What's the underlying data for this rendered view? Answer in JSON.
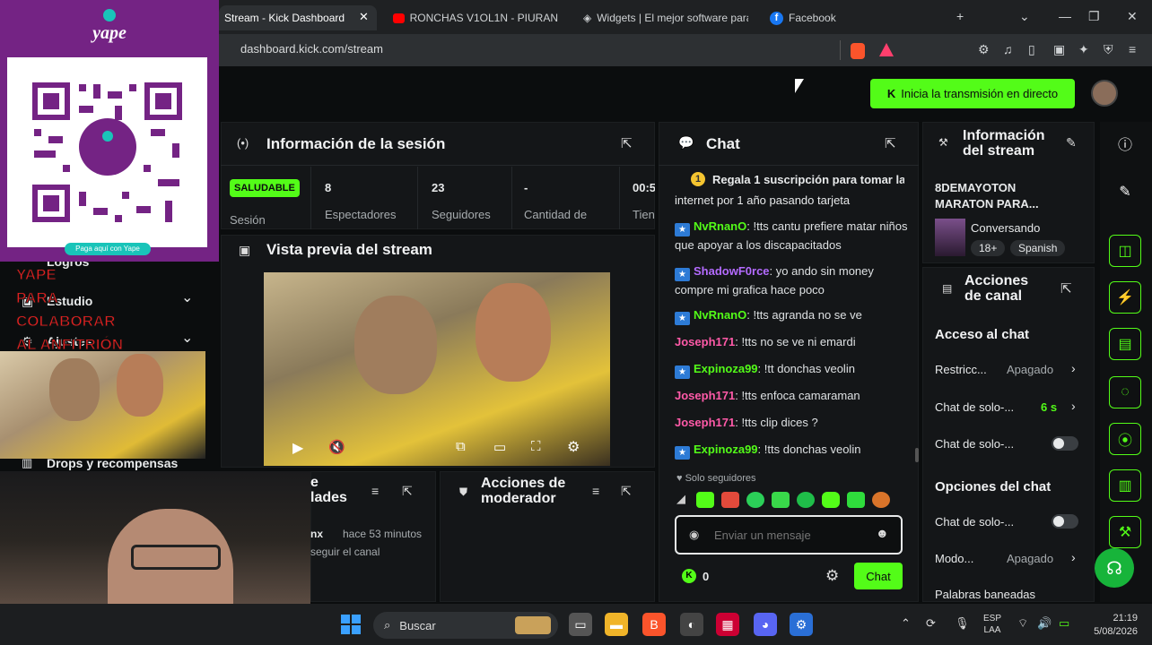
{
  "browser": {
    "tabs": [
      {
        "label": "Stream - Kick Dashboard",
        "active": true
      },
      {
        "label": "RONCHAS V1OL1N - PIURAN"
      },
      {
        "label": "Widgets | El mejor software para"
      },
      {
        "label": "Facebook"
      }
    ],
    "url": "dashboard.kick.com/stream"
  },
  "header": {
    "go_live_label": "Inicia la transmisión en directo"
  },
  "session": {
    "title": "Información de la sesión",
    "health": "SALUDABLE",
    "health_label": "Sesión",
    "stats": [
      {
        "value": "8",
        "label": "Espectadores"
      },
      {
        "value": "23",
        "label": "Seguidores"
      },
      {
        "value": "-",
        "label": "Cantidad de"
      },
      {
        "value": "00:5",
        "label": "Tien"
      }
    ]
  },
  "preview": {
    "title": "Vista previa del stream"
  },
  "left_nav": {
    "logros": "Logros",
    "estudio": "Estudio",
    "ajustes": "Ajustes",
    "drops": "Drops y recompensas"
  },
  "activity": {
    "title_a": "e",
    "title_b": "lades",
    "time": "hace 53 minutos",
    "user": "nx",
    "action": "seguir el canal"
  },
  "mod": {
    "title_a": "Acciones de",
    "title_b": "moderador"
  },
  "chat": {
    "title": "Chat",
    "sub_line1": "Regala 1 suscripción para tomar la",
    "sub_line2": "internet por 1 año pasando tarjeta",
    "messages": [
      {
        "user": "NvRnanO",
        "text": "!tts cantu prefiere matar niños que apoyar a los discapacitados"
      },
      {
        "user": "ShadowF0rce",
        "text": "yo ando sin money compre mi grafica hace poco"
      },
      {
        "user": "NvRnanO",
        "text": "!tts agranda no se ve"
      },
      {
        "user": "Joseph171",
        "text": "!tts no se ve ni emardi"
      },
      {
        "user": "Expinoza99",
        "text": "!tt donchas veolin"
      },
      {
        "user": "Joseph171",
        "text": "!tts enfoca camaraman"
      },
      {
        "user": "Joseph171",
        "text": "!tts clip dices ?"
      },
      {
        "user": "Expinoza99",
        "text": "!tts donchas veolin"
      }
    ],
    "mode": "Solo seguidores",
    "placeholder": "Enviar un mensaje",
    "points": "0",
    "send_label": "Chat"
  },
  "stream_info": {
    "title_a": "Información",
    "title_b": "del stream",
    "stream_title_a": "8DEMAYOTON",
    "stream_title_b": "MARATON PARA...",
    "category": "Conversando",
    "tags": [
      "18+",
      "Spanish"
    ]
  },
  "channel_actions": {
    "title_a": "Acciones",
    "title_b": "de canal",
    "chat_access": "Acceso al chat",
    "rows": [
      {
        "label": "Restricc...",
        "value": "Apagado"
      },
      {
        "label": "Chat de solo-...",
        "value": "6 s"
      },
      {
        "label": "Chat de solo-...",
        "value": ""
      }
    ],
    "chat_options": "Opciones del chat",
    "rows2": [
      {
        "label": "Chat de solo-...",
        "value": ""
      },
      {
        "label": "Modo...",
        "value": "Apagado"
      },
      {
        "label": "Palabras baneadas",
        "value": ""
      }
    ]
  },
  "overlay": {
    "yape_logo": "yape",
    "qr_caption": "Paga aquí con Yape",
    "red_lines": [
      "YAPE",
      "PARA",
      "COLABORAR",
      "AL ANFITRIÓN"
    ]
  },
  "taskbar": {
    "search": "Buscar",
    "lang_a": "ESP",
    "lang_b": "LAA",
    "time": "21:19",
    "date": "5/08/2026"
  }
}
